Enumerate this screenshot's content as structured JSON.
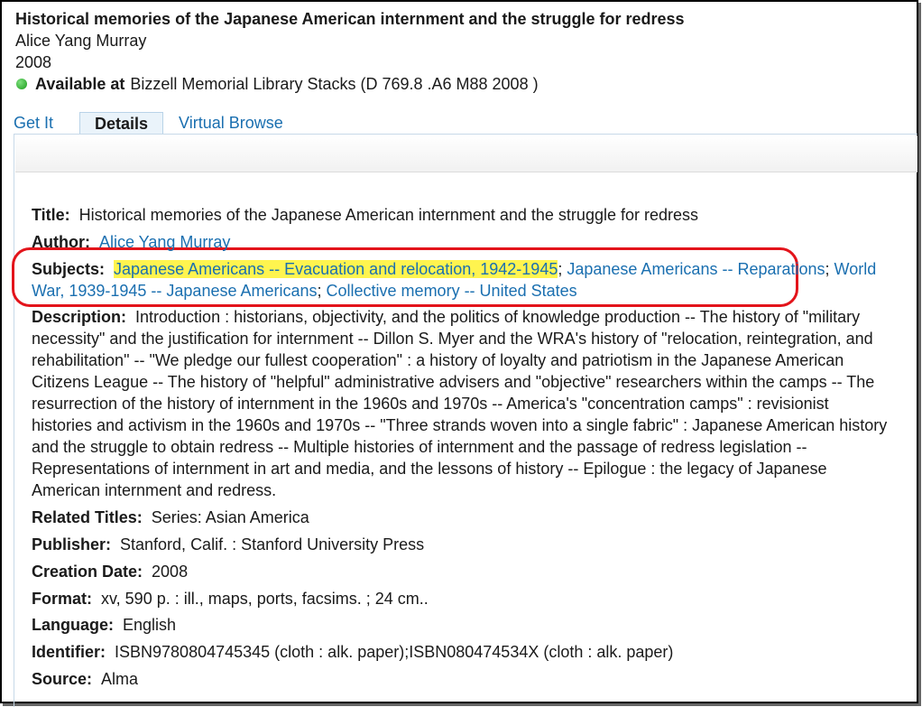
{
  "record": {
    "title": "Historical memories of the Japanese American internment and the struggle for redress",
    "author": "Alice Yang Murray",
    "year": "2008",
    "availability_label": "Available at",
    "availability_location": "Bizzell Memorial Library Stacks (D 769.8 .A6 M88 2008 )",
    "status_color": "#1a9a1a"
  },
  "tabs": [
    {
      "label": "Get It"
    },
    {
      "label": "Details",
      "active": true
    },
    {
      "label": "Virtual Browse"
    }
  ],
  "details": {
    "title_label": "Title:",
    "title_value": "Historical memories of the Japanese American internment and the struggle for redress",
    "author_label": "Author:",
    "author_value": "Alice Yang Murray",
    "subjects_label": "Subjects:",
    "subjects": [
      "Japanese Americans -- Evacuation and relocation, 1942-1945",
      "Japanese Americans -- Reparations",
      "World War, 1939-1945 -- Japanese Americans",
      "Collective memory -- United States"
    ],
    "subject_separator": "; ",
    "description_label": "Description:",
    "description_value": "Introduction : historians, objectivity, and the politics of knowledge production -- The history of \"military necessity\" and the justification for internment -- Dillon S. Myer and the WRA's history of \"relocation, reintegration, and rehabilitation\" -- \"We pledge our fullest cooperation\" : a history of loyalty and patriotism in the Japanese American Citizens League -- The history of \"helpful\" administrative advisers and \"objective\" researchers within the camps -- The resurrection of the history of internment in the 1960s and 1970s -- America's \"concentration camps\" : revisionist histories and activism in the 1960s and 1970s -- \"Three strands woven into a single fabric\" : Japanese American history and the struggle to obtain redress -- Multiple histories of internment and the passage of redress legislation -- Representations of internment in art and media, and the lessons of history -- Epilogue : the legacy of Japanese American internment and redress.",
    "related_label": "Related Titles:",
    "related_value": "Series: Asian America",
    "publisher_label": "Publisher:",
    "publisher_value": "Stanford, Calif. : Stanford University Press",
    "creation_label": "Creation Date:",
    "creation_value": "2008",
    "format_label": "Format:",
    "format_value": "xv, 590 p. : ill., maps, ports, facsims. ; 24 cm..",
    "language_label": "Language:",
    "language_value": "English",
    "identifier_label": "Identifier:",
    "identifier_value": "ISBN9780804745345 (cloth : alk. paper);ISBN080474534X (cloth : alk. paper)",
    "source_label": "Source:",
    "source_value": "Alma"
  },
  "colors": {
    "link": "#1a6fb0",
    "highlight": "#fff44f",
    "annotation_box": "#e3141b"
  }
}
